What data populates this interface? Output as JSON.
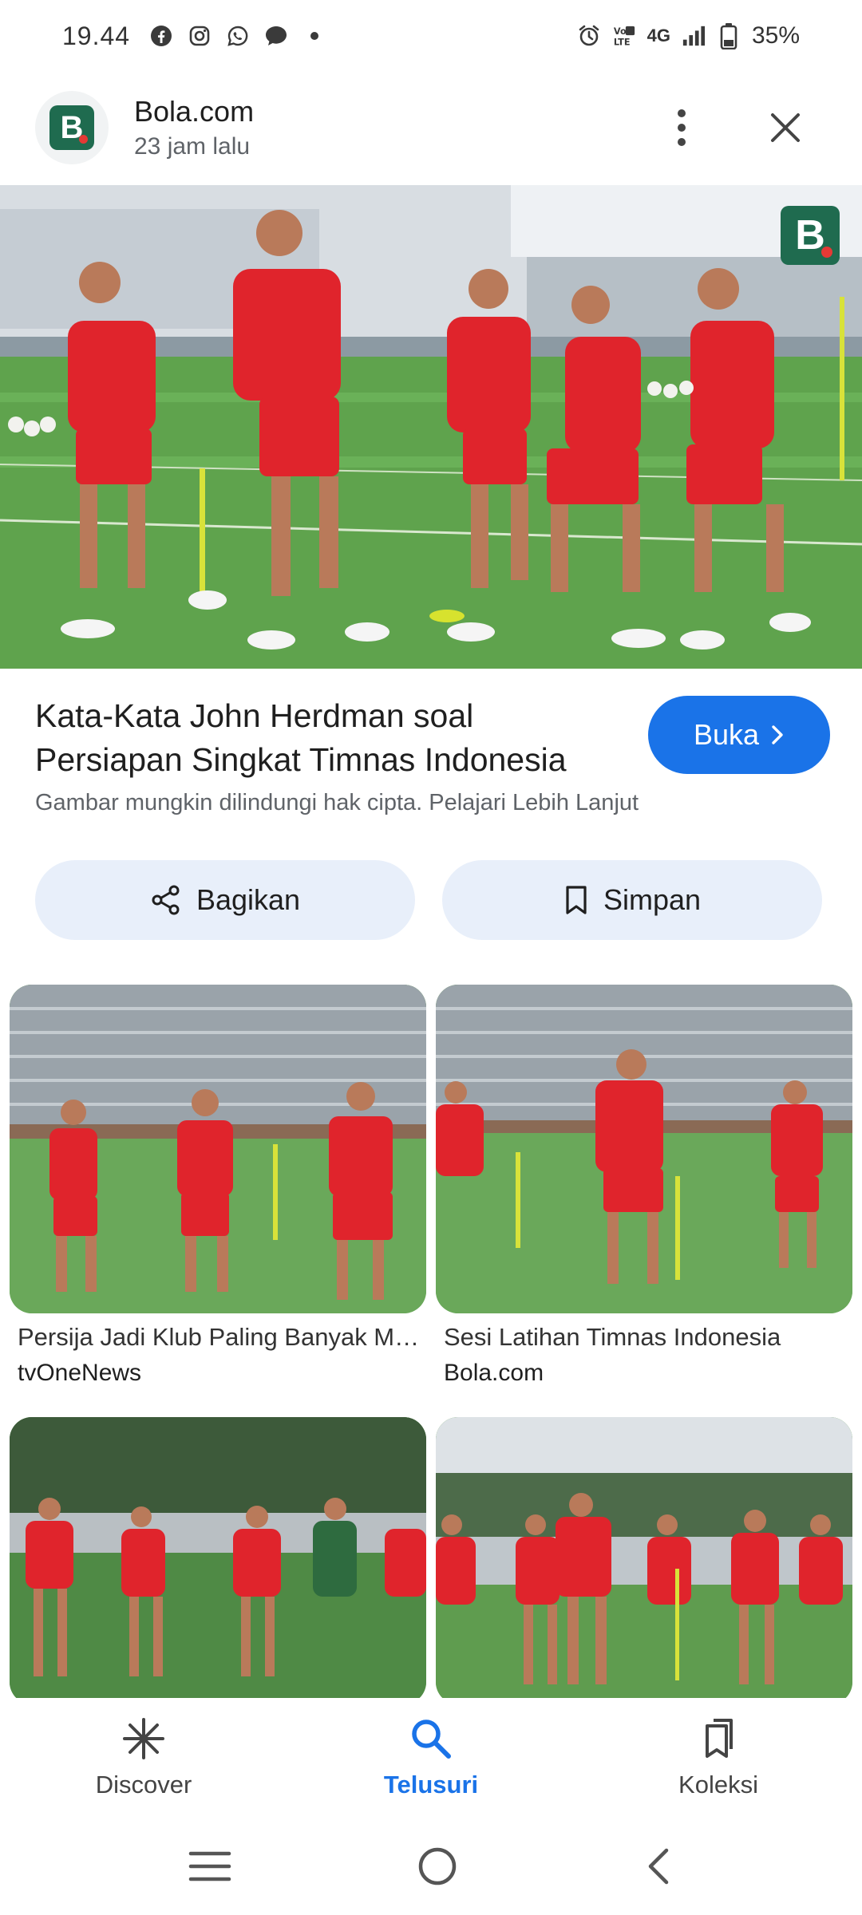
{
  "status_bar": {
    "time": "19.44",
    "network": "4G",
    "battery": "35%",
    "left_icons": [
      "facebook-icon",
      "instagram-icon",
      "whatsapp-icon",
      "message-icon",
      "dot-icon"
    ],
    "right_icons": [
      "alarm-icon",
      "volte-icon",
      "signal-icon",
      "battery-icon"
    ]
  },
  "header": {
    "site_name": "Bola.com",
    "time_ago": "23 jam lalu",
    "logo_letter": "B"
  },
  "hero": {
    "badge_letter": "B"
  },
  "article": {
    "title": "Kata-Kata John Herdman soal Persiapan Singkat Timnas Indonesia",
    "open_label": "Buka",
    "copyright_note": "Gambar mungkin dilindungi hak cipta. Pelajari Lebih Lanjut"
  },
  "actions": {
    "share_label": "Bagikan",
    "save_label": "Simpan"
  },
  "related": [
    {
      "title": "Persija Jadi Klub Paling Banyak Menyumbang Pemain",
      "source": "tvOneNews"
    },
    {
      "title": "Sesi Latihan Timnas Indonesia",
      "source": "Bola.com"
    },
    {
      "title": "",
      "source": ""
    },
    {
      "title": "",
      "source": ""
    }
  ],
  "bottom_nav": {
    "items": [
      {
        "label": "Discover",
        "icon": "asterisk-icon"
      },
      {
        "label": "Telusuri",
        "icon": "search-icon"
      },
      {
        "label": "Koleksi",
        "icon": "collections-icon"
      }
    ],
    "active": "Telusuri"
  },
  "colors": {
    "accent": "#1a73e8",
    "brand_green": "#1f6b4f",
    "chip_bg": "#e8effa",
    "jersey_red": "#e0242c",
    "pitch_green": "#5a9d4a"
  }
}
